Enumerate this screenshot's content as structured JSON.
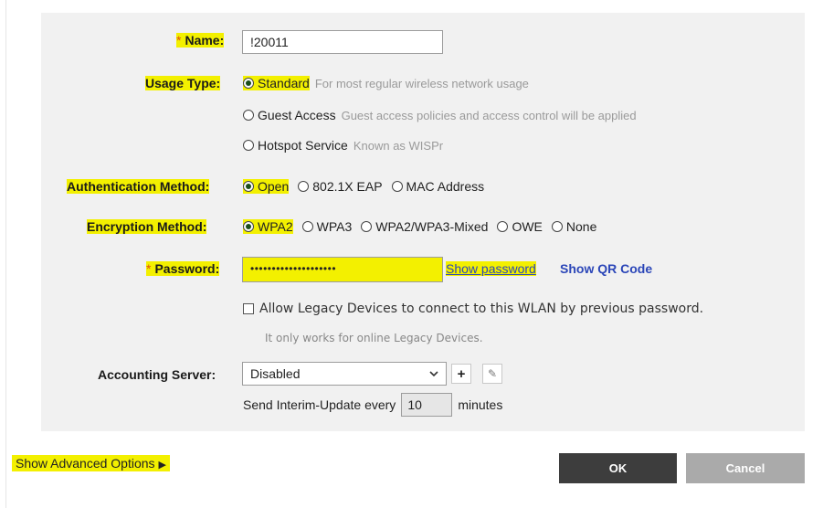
{
  "form": {
    "name": {
      "required_mark": "*",
      "label": "Name:",
      "value": "!20011"
    },
    "usage_type": {
      "label": "Usage Type:",
      "options": [
        {
          "label": "Standard",
          "hint": "For most regular wireless network usage",
          "selected": true
        },
        {
          "label": "Guest Access",
          "hint": "Guest access policies and access control will be applied",
          "selected": false
        },
        {
          "label": "Hotspot Service",
          "hint": "Known as WISPr",
          "selected": false
        }
      ]
    },
    "auth_method": {
      "label": "Authentication Method:",
      "options": [
        {
          "label": "Open",
          "selected": true
        },
        {
          "label": "802.1X EAP",
          "selected": false
        },
        {
          "label": "MAC Address",
          "selected": false
        }
      ]
    },
    "encryption_method": {
      "label": "Encryption Method:",
      "options": [
        {
          "label": "WPA2",
          "selected": true
        },
        {
          "label": "WPA3",
          "selected": false
        },
        {
          "label": "WPA2/WPA3-Mixed",
          "selected": false
        },
        {
          "label": "OWE",
          "selected": false
        },
        {
          "label": "None",
          "selected": false
        }
      ]
    },
    "password": {
      "required_mark": "*",
      "label": "Password:",
      "masked_value": "••••••••••••••••••••",
      "show_password": "Show password",
      "show_qr": "Show QR Code"
    },
    "legacy": {
      "label": "Allow Legacy Devices to connect to this WLAN by previous password.",
      "note": "It only works for online Legacy Devices.",
      "checked": false
    },
    "accounting": {
      "label": "Accounting Server:",
      "value": "Disabled",
      "add_glyph": "+",
      "edit_glyph": "✎"
    },
    "interim": {
      "prefix": "Send Interim-Update every",
      "value": "10",
      "suffix": "minutes"
    }
  },
  "footer": {
    "advanced_label": "Show Advanced Options",
    "advanced_glyph": "▶",
    "ok": "OK",
    "cancel": "Cancel"
  },
  "colors": {
    "highlight": "#f3f000",
    "required": "#e05010",
    "link": "#2b46b8",
    "ok_button": "#3d3d3d",
    "cancel_button": "#aaaaaa"
  }
}
